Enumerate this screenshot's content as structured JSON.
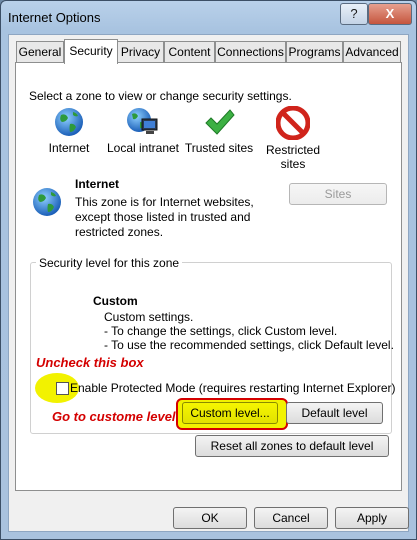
{
  "window": {
    "title": "Internet Options",
    "help_button": "?",
    "close_button": "X"
  },
  "tabs": [
    {
      "label": "General"
    },
    {
      "label": "Security"
    },
    {
      "label": "Privacy"
    },
    {
      "label": "Content"
    },
    {
      "label": "Connections"
    },
    {
      "label": "Programs"
    },
    {
      "label": "Advanced"
    }
  ],
  "zones_prompt": "Select a zone to view or change security settings.",
  "zones": [
    {
      "label": "Internet",
      "icon": "globe-icon"
    },
    {
      "label": "Local intranet",
      "icon": "intranet-icon"
    },
    {
      "label": "Trusted sites",
      "icon": "checkmark-icon"
    },
    {
      "label": "Restricted sites",
      "icon": "restricted-icon"
    }
  ],
  "selected_zone": {
    "name": "Internet",
    "description": [
      "This zone is for Internet websites,",
      "except those listed in trusted and",
      "restricted zones."
    ],
    "sites_button": "Sites"
  },
  "security_level": {
    "group_title": "Security level for this zone",
    "level_name": "Custom",
    "lines": [
      "Custom settings.",
      "- To change the settings, click Custom level.",
      "- To use the recommended settings, click Default level."
    ],
    "protected_mode_label": "Enable Protected Mode (requires restarting Internet Explorer)",
    "protected_mode_checked": false,
    "custom_level_button": "Custom level...",
    "default_level_button": "Default level"
  },
  "annotations": {
    "uncheck": "Uncheck this box",
    "custom": "Go to custome level",
    "color": "#d40000",
    "highlight": "#f2f200"
  },
  "reset_button": "Reset all zones to default level",
  "footer": {
    "ok": "OK",
    "cancel": "Cancel",
    "apply": "Apply"
  }
}
